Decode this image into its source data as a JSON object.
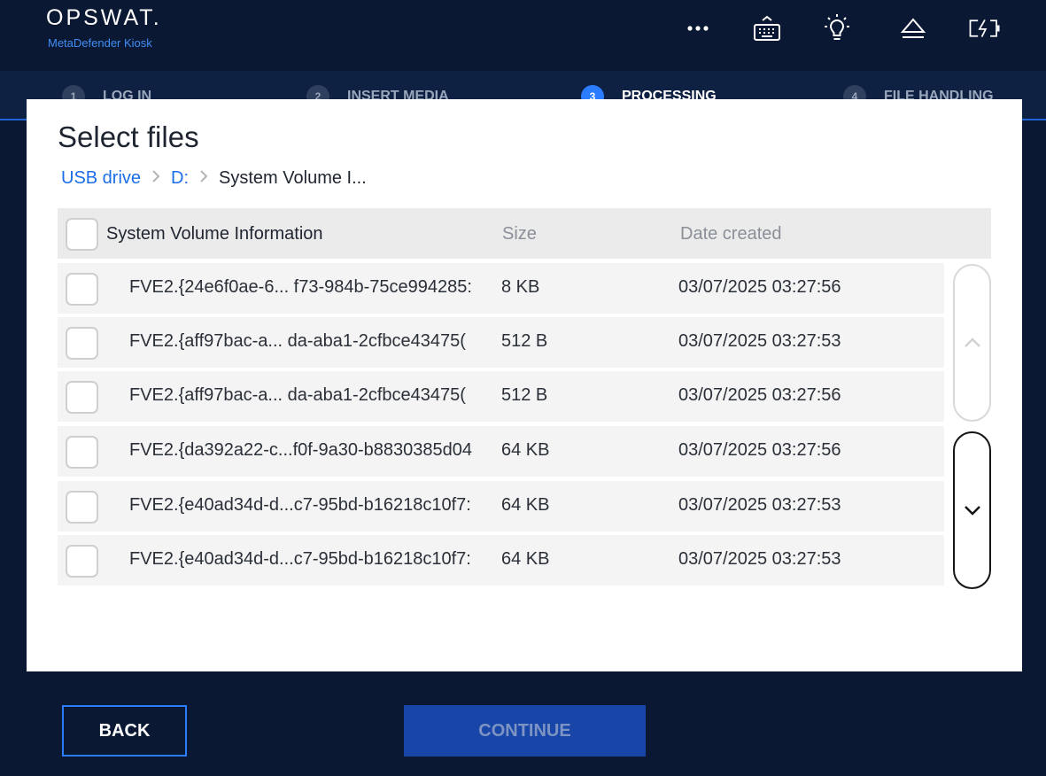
{
  "header": {
    "logo_text": "OPSWAT.",
    "logo_subtitle": "MetaDefender Kiosk",
    "icons": [
      "more-options-icon",
      "keyboard-icon",
      "light-bulb-icon",
      "eject-icon",
      "battery-charging-icon"
    ]
  },
  "steps": [
    {
      "number": "1",
      "label": "LOG IN"
    },
    {
      "number": "2",
      "label": "INSERT MEDIA"
    },
    {
      "number": "3",
      "label": "PROCESSING",
      "active": true
    },
    {
      "number": "4",
      "label": "FILE HANDLING"
    }
  ],
  "dialog": {
    "title": "Select files",
    "breadcrumb": [
      "USB drive",
      "D:",
      "System Volume I..."
    ]
  },
  "table": {
    "header": {
      "name": "System Volume Information",
      "size": "Size",
      "date": "Date created"
    },
    "rows": [
      {
        "name": "FVE2.{24e6f0ae-6... f73-984b-75ce994285:",
        "size": "8 KB",
        "date": "03/07/2025 03:27:56"
      },
      {
        "name": "FVE2.{aff97bac-a...  da-aba1-2cfbce43475(",
        "size": "512 B",
        "date": "03/07/2025 03:27:53"
      },
      {
        "name": "FVE2.{aff97bac-a...  da-aba1-2cfbce43475(",
        "size": "512 B",
        "date": "03/07/2025 03:27:56"
      },
      {
        "name": "FVE2.{da392a22-c...f0f-9a30-b8830385d04",
        "size": "64 KB",
        "date": "03/07/2025 03:27:56"
      },
      {
        "name": "FVE2.{e40ad34d-d...c7-95bd-b16218c10f7:",
        "size": "64 KB",
        "date": "03/07/2025 03:27:53"
      },
      {
        "name": "FVE2.{e40ad34d-d...c7-95bd-b16218c10f7:",
        "size": "64 KB",
        "date": "03/07/2025 03:27:53"
      }
    ]
  },
  "footer": {
    "back_label": "BACK",
    "continue_label": "CONTINUE"
  },
  "colors": {
    "background": "#0b1833",
    "accent": "#2b7cff",
    "link": "#1b6ee8",
    "continue_disabled": "#1846a8"
  }
}
